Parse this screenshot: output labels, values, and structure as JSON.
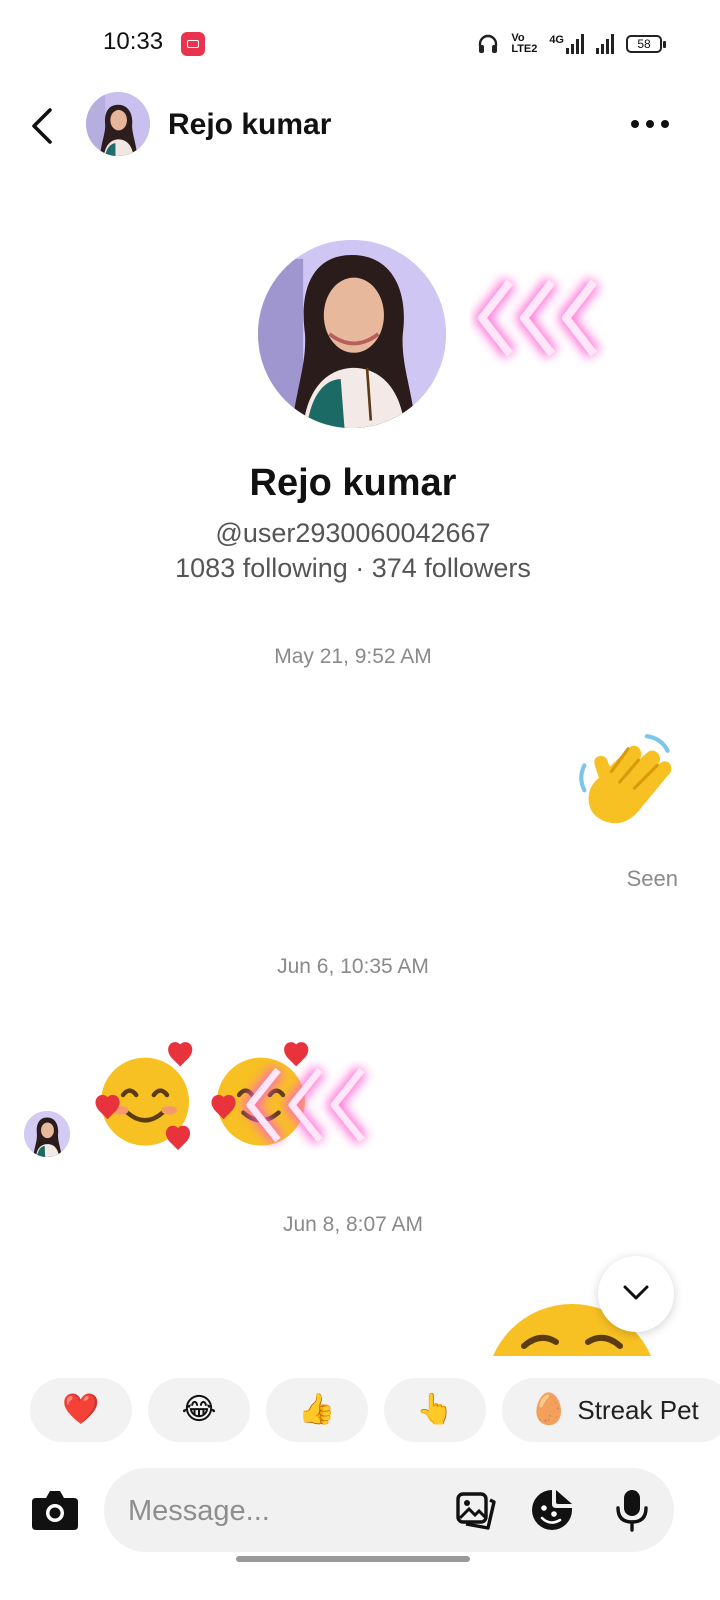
{
  "status_bar": {
    "time": "10:33",
    "network_label": "4G",
    "volte_label": "Vo LTE2",
    "battery": "58"
  },
  "header": {
    "name": "Rejo kumar"
  },
  "profile": {
    "name": "Rejo kumar",
    "handle": "@user2930060042667",
    "stats": "1083 following · 374 followers"
  },
  "messages": {
    "ts1": "May 21, 9:52 AM",
    "seen": "Seen",
    "ts2": "Jun 6, 10:35 AM",
    "ts3": "Jun 8, 8:07 AM"
  },
  "quick_reactions": [
    {
      "emoji": "❤️",
      "icon": "heart-icon"
    },
    {
      "emoji": "😂",
      "icon": "laugh-icon"
    },
    {
      "emoji": "👍",
      "icon": "thumbs-up-icon"
    },
    {
      "emoji": "👆",
      "icon": "point-up-icon"
    },
    {
      "emoji": "🥚",
      "label": "Streak Pet",
      "icon": "streak-pet-icon"
    }
  ],
  "composer": {
    "placeholder": "Message..."
  },
  "colors": {
    "accent_record": "#e8344e",
    "chip_bg": "#f2f2f2",
    "glow_pink": "#ff5fd2"
  }
}
